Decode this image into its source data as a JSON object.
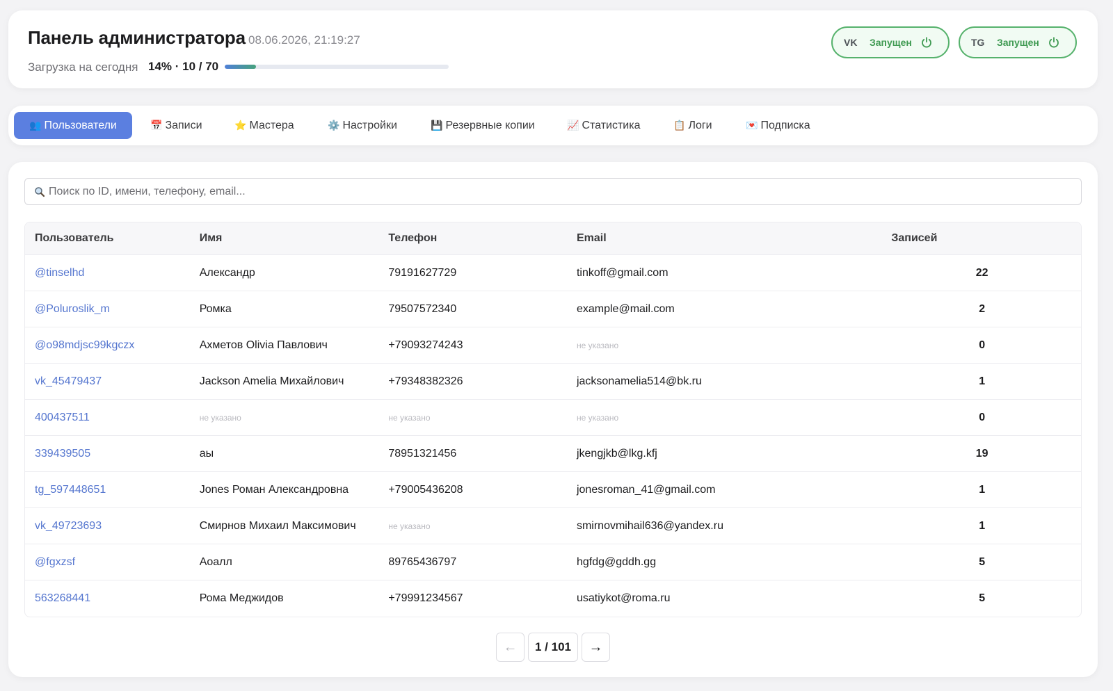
{
  "header": {
    "title": "Панель администратора",
    "datetime": "08.06.2026, 21:19:27",
    "load_label": "Загрузка на сегодня",
    "load_value": "14% · 10 / 70",
    "load_fraction": 0.14
  },
  "services": [
    {
      "code": "VK",
      "status": "Запущен"
    },
    {
      "code": "TG",
      "status": "Запущен"
    }
  ],
  "tabs": [
    {
      "icon": "👥",
      "label": "Пользователи",
      "active": true
    },
    {
      "icon": "📅",
      "label": "Записи"
    },
    {
      "icon": "⭐",
      "label": "Мастера"
    },
    {
      "icon": "⚙️",
      "label": "Настройки"
    },
    {
      "icon": "💾",
      "label": "Резервные копии"
    },
    {
      "icon": "📈",
      "label": "Статистика"
    },
    {
      "icon": "📋",
      "label": "Логи"
    },
    {
      "icon": "💌",
      "label": "Подписка"
    }
  ],
  "search": {
    "placeholder": "Поиск по ID, имени, телефону, email..."
  },
  "table": {
    "headers": [
      "Пользователь",
      "Имя",
      "Телефон",
      "Email",
      "Записей"
    ],
    "empty_text": "не указано",
    "rows": [
      {
        "user": "@tinselhd",
        "name": "Александр",
        "phone": "79191627729",
        "email": "tinkoff@gmail.com",
        "count": "22"
      },
      {
        "user": "@Poluroslik_m",
        "name": "Ромка",
        "phone": "79507572340",
        "email": "example@mail.com",
        "count": "2"
      },
      {
        "user": "@o98mdjsc99kgczx",
        "name": "Ахметов Olivia Павлович",
        "phone": "+79093274243",
        "email": null,
        "count": "0"
      },
      {
        "user": "vk_45479437",
        "name": "Jackson Amelia Михайлович",
        "phone": "+79348382326",
        "email": "jacksonamelia514@bk.ru",
        "count": "1"
      },
      {
        "user": "400437511",
        "name": null,
        "phone": null,
        "email": null,
        "count": "0"
      },
      {
        "user": "339439505",
        "name": "аы",
        "phone": "78951321456",
        "email": "jkengjkb@lkg.kfj",
        "count": "19"
      },
      {
        "user": "tg_597448651",
        "name": "Jones Роман Александровна",
        "phone": "+79005436208",
        "email": "jonesroman_41@gmail.com",
        "count": "1"
      },
      {
        "user": "vk_49723693",
        "name": "Смирнов Михаил Максимович",
        "phone": null,
        "email": "smirnovmihail636@yandex.ru",
        "count": "1"
      },
      {
        "user": "@fgxzsf",
        "name": "Аоалл",
        "phone": "89765436797",
        "email": "hgfdg@gddh.gg",
        "count": "5"
      },
      {
        "user": "563268441",
        "name": "Рома Меджидов",
        "phone": "+79991234567",
        "email": "usatiykot@roma.ru",
        "count": "5"
      }
    ]
  },
  "pagination": {
    "prev": "←",
    "info": "1 / 101",
    "next": "→"
  }
}
